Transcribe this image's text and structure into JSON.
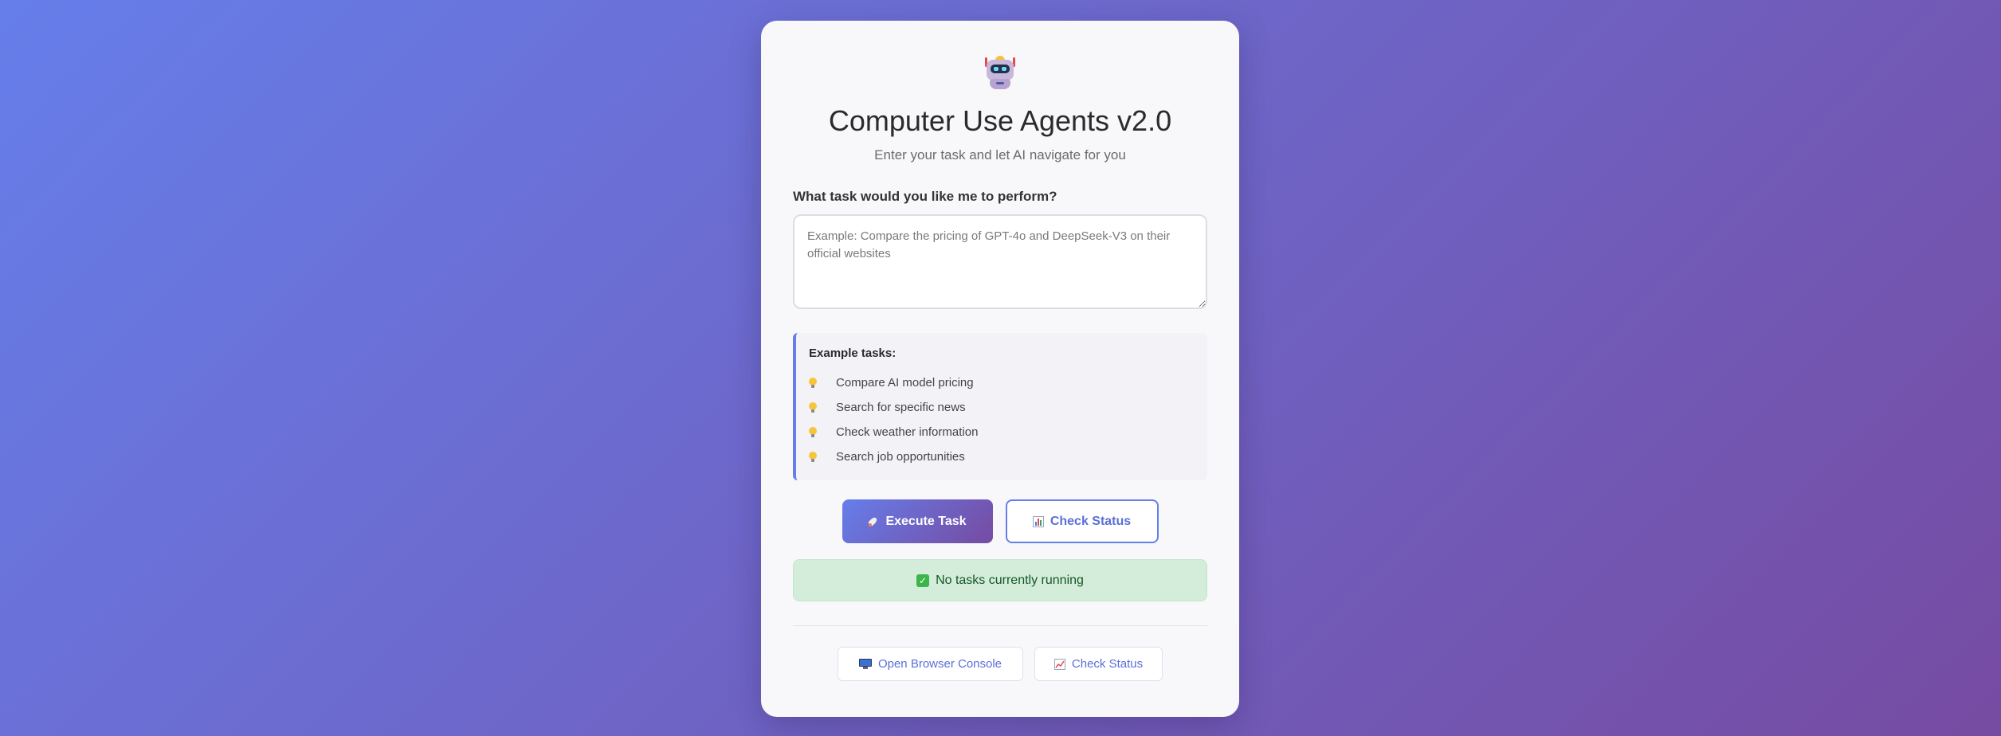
{
  "header": {
    "icon": "robot-icon",
    "title": "Computer Use Agents v2.0",
    "subtitle": "Enter your task and let AI navigate for you"
  },
  "task": {
    "label": "What task would you like me to perform?",
    "placeholder": "Example: Compare the pricing of GPT-4o and DeepSeek-V3 on their official websites",
    "value": ""
  },
  "examples": {
    "title": "Example tasks:",
    "icon": "lightbulb-icon",
    "items": [
      "Compare AI model pricing",
      "Search for specific news",
      "Check weather information",
      "Search job opportunities"
    ]
  },
  "actions": {
    "execute_label": "Execute Task",
    "execute_icon": "rocket-icon",
    "check_status_label": "Check Status",
    "check_status_icon": "bar-chart-icon"
  },
  "status": {
    "icon": "check-mark-icon",
    "text": "No tasks currently running",
    "color": "#155724",
    "background": "#d4edda"
  },
  "footer": {
    "console_label": "Open Browser Console",
    "console_icon": "desktop-computer-icon",
    "status_label": "Check Status",
    "status_icon": "trending-up-icon"
  },
  "colors": {
    "gradient_start": "#667eea",
    "gradient_end": "#764ba2",
    "accent": "#5a6fd8"
  }
}
